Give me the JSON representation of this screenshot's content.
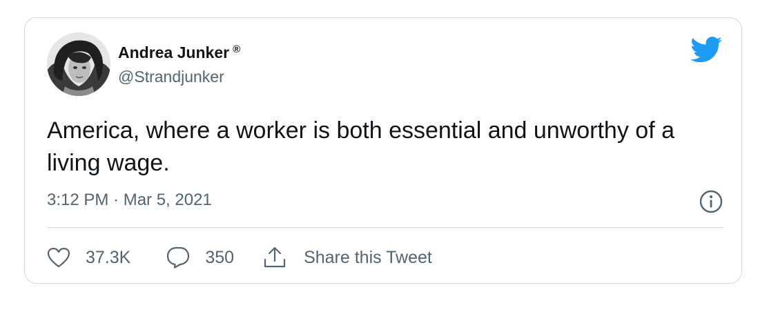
{
  "author": {
    "display_name": "Andrea Junker",
    "verified_mark": "®",
    "handle": "@Strandjunker",
    "avatar_icon": "profile-photo"
  },
  "brand": {
    "logo_icon": "twitter-bird-icon",
    "logo_color": "#1d9bf0"
  },
  "tweet": {
    "text": "America, where a worker is both essential and unworthy of a living wage.",
    "timestamp": "3:12 PM · Mar 5, 2021",
    "info_icon": "info-icon"
  },
  "actions": {
    "like_icon": "heart-icon",
    "like_count": "37.3K",
    "reply_icon": "speech-bubble-icon",
    "reply_count": "350",
    "share_icon": "share-upload-icon",
    "share_label": "Share this Tweet"
  },
  "colors": {
    "text_primary": "#0f1419",
    "text_secondary": "#536471",
    "border": "#cfd9de"
  }
}
